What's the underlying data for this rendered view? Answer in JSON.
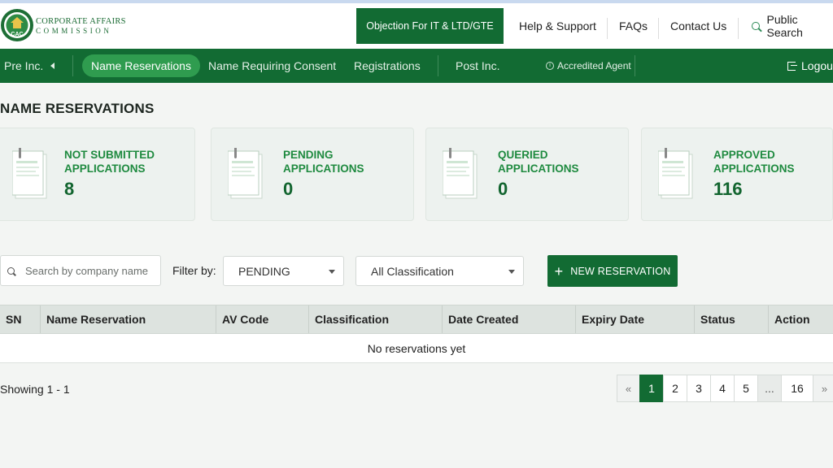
{
  "header": {
    "brand_line1": "CORPORATE AFFAIRS",
    "brand_line2": "COMMISSION",
    "logo_text": "CAC",
    "objection_button": "Objection For IT & LTD/GTE",
    "help": "Help & Support",
    "faqs": "FAQs",
    "contact": "Contact Us",
    "public_search": "Public Search"
  },
  "nav": {
    "pre_inc": "Pre Inc.",
    "name_reservations": "Name Reservations",
    "name_requiring_consent": "Name Requiring Consent",
    "registrations": "Registrations",
    "post_inc": "Post Inc.",
    "accredited_agent": "Accredited Agent",
    "logout": "Logout"
  },
  "page": {
    "title": "NAME RESERVATIONS"
  },
  "cards": [
    {
      "label": "NOT SUBMITTED APPLICATIONS",
      "count": "8"
    },
    {
      "label": "PENDING APPLICATIONS",
      "count": "0"
    },
    {
      "label": "QUERIED APPLICATIONS",
      "count": "0"
    },
    {
      "label": "APPROVED APPLICATIONS",
      "count": "116"
    }
  ],
  "filters": {
    "search_placeholder": "Search by company name",
    "filter_label": "Filter by:",
    "status_selected": "PENDING",
    "classification_selected": "All Classification",
    "new_reservation": "NEW RESERVATION"
  },
  "table": {
    "columns": [
      "SN",
      "Name Reservation",
      "AV Code",
      "Classification",
      "Date Created",
      "Expiry Date",
      "Status",
      "Action"
    ],
    "empty_message": "No reservations yet"
  },
  "footer": {
    "showing": "Showing 1 - 1",
    "pages": [
      "«",
      "1",
      "2",
      "3",
      "4",
      "5",
      "...",
      "16",
      "»"
    ],
    "active_page": "1"
  },
  "colors": {
    "brand_green": "#126b33",
    "active_pill": "#2f9c4f",
    "card_label": "#1e8a3f"
  }
}
